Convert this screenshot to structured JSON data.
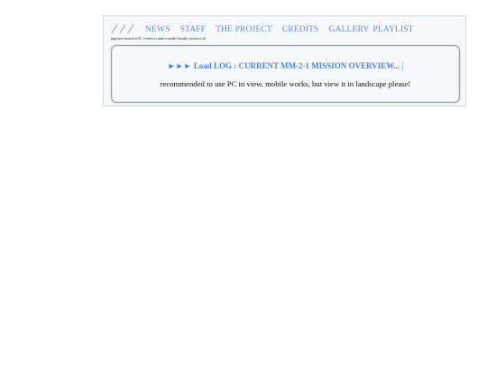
{
  "header": {
    "logo_icon": "slash-marks-logo-icon",
    "nav": [
      {
        "label": "NEWS"
      },
      {
        "label": "STAFF"
      },
      {
        "label": "THE PROJECT"
      },
      {
        "label": "CREDITS"
      },
      {
        "label": "GALLERY"
      },
      {
        "label": "PLAYLIST"
      }
    ],
    "note": "page best viewed on PC. I refuse to make a mobile friendly version at all"
  },
  "panel": {
    "arrows": "►►►",
    "load_text": "Load LOG : CURRENT MM-2-1 MISSION OVERVIEW...",
    "cursor": "|",
    "recommendation": "recommended to use PC to view. mobile works, but view it in landscape please!"
  },
  "colors": {
    "link": "#5b8fd6",
    "load_text": "#4a85d4",
    "panel_border": "#9aa0a8",
    "background": "#f7f8fa"
  }
}
